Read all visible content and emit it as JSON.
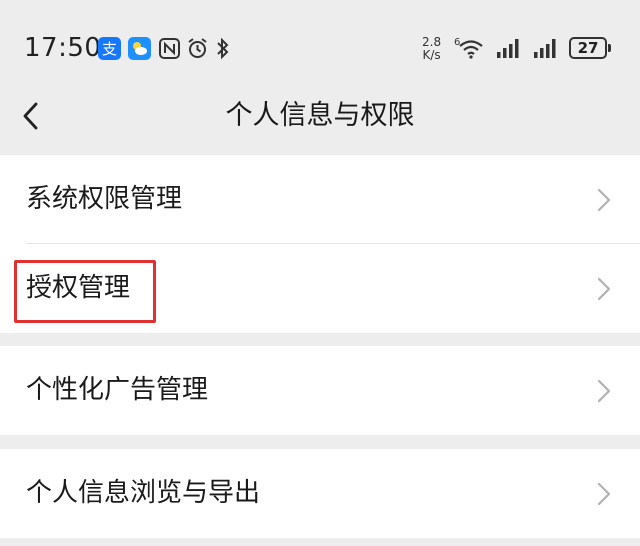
{
  "status_bar": {
    "time": "17:50",
    "speed_value": "2.8",
    "speed_unit": "K/s",
    "battery": "27",
    "icons": [
      "alipay-icon",
      "weather-icon",
      "nfc-icon",
      "alarm-icon",
      "bluetooth-icon",
      "wifi-icon",
      "signal-icon",
      "signal-icon",
      "battery-icon"
    ]
  },
  "header": {
    "title": "个人信息与权限",
    "back_icon": "chevron-left-icon"
  },
  "groups": [
    {
      "items": [
        {
          "label": "系统权限管理"
        },
        {
          "label": "授权管理",
          "highlighted": true
        }
      ]
    },
    {
      "items": [
        {
          "label": "个性化广告管理"
        }
      ]
    },
    {
      "items": [
        {
          "label": "个人信息浏览与导出"
        }
      ]
    }
  ],
  "colors": {
    "background": "#ededed",
    "card": "#ffffff",
    "highlight": "#e03131",
    "chevron": "#b2b2b2"
  }
}
